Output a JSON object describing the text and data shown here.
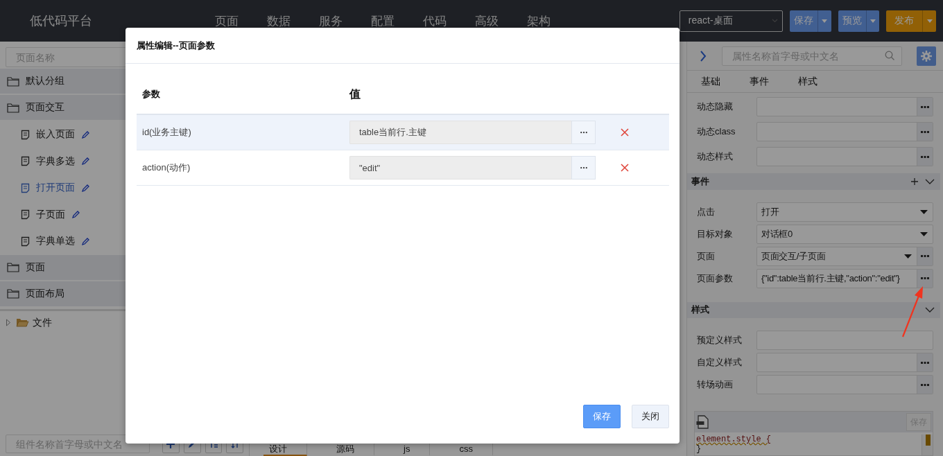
{
  "app_title": "低代码平台",
  "nav": [
    "页面",
    "数据",
    "服务",
    "配置",
    "代码",
    "高级",
    "架构"
  ],
  "framework_select": {
    "value": "react-桌面"
  },
  "actions": [
    {
      "label": "保存",
      "kind": "primary"
    },
    {
      "label": "预览",
      "kind": "primary"
    },
    {
      "label": "发布",
      "kind": "warning"
    }
  ],
  "sidebar": {
    "search": {
      "placeholder": "页面名称"
    },
    "tree": [
      {
        "label": "默认分组"
      },
      {
        "label": "页面交互",
        "children": [
          {
            "label": "嵌入页面",
            "selected": false
          },
          {
            "label": "字典多选",
            "selected": false
          },
          {
            "label": "打开页面",
            "selected": true
          },
          {
            "label": "子页面",
            "selected": false
          },
          {
            "label": "字典单选",
            "selected": false
          }
        ]
      },
      {
        "label": "页面"
      },
      {
        "label": "页面布局"
      }
    ],
    "files": [
      {
        "label": "文件",
        "expanded": false
      }
    ],
    "component_search": {
      "placeholder": "组件名称首字母或中文名"
    }
  },
  "canvas_tabs": [
    {
      "label": "设计",
      "selected": true
    },
    {
      "label": "源码",
      "selected": false
    },
    {
      "label": "js",
      "selected": false
    },
    {
      "label": "css",
      "selected": false
    }
  ],
  "properties": {
    "search": {
      "placeholder": "属性名称首字母或中文名"
    },
    "tabs": [
      "基础",
      "事件",
      "样式"
    ],
    "sections": [
      {
        "rows": [
          {
            "label": "动态隐藏",
            "kind": "input",
            "more": true
          },
          {
            "label": "动态class",
            "kind": "input",
            "more": true
          },
          {
            "label": "动态样式",
            "kind": "input",
            "more": true
          }
        ]
      },
      {
        "title": "事件",
        "add": true,
        "rows": [
          {
            "label": "点击",
            "kind": "select",
            "value": "打开",
            "more": false
          },
          {
            "label": "目标对象",
            "kind": "select",
            "value": "对话框0",
            "more": false
          },
          {
            "label": "页面",
            "kind": "select",
            "value": "页面交互/子页面",
            "more": true
          },
          {
            "label": "页面参数",
            "kind": "input",
            "value": "{\"id\":table当前行.主键,\"action\":\"edit\"}",
            "more": true
          }
        ]
      },
      {
        "title": "样式",
        "add": false,
        "rows": [
          {
            "label": "预定义样式",
            "kind": "input",
            "more": false
          },
          {
            "label": "自定义样式",
            "kind": "input",
            "more": true
          },
          {
            "label": "转场动画",
            "kind": "input",
            "more": true
          }
        ]
      }
    ],
    "code_editor": {
      "save": {
        "label": "保存",
        "disabled": true
      },
      "lines": [
        "element.style {",
        "}"
      ]
    }
  },
  "modal": {
    "title": "属性编辑--页面参数",
    "columns": [
      "参数",
      "值"
    ],
    "rows": [
      {
        "name": "id(业务主键)",
        "value": "table当前行.主键",
        "selected": true
      },
      {
        "name": "action(动作)",
        "value": "\"edit\"",
        "selected": false
      }
    ],
    "buttons": [
      {
        "label": "保存",
        "kind": "primary"
      },
      {
        "label": "关闭",
        "kind": "default"
      }
    ]
  }
}
